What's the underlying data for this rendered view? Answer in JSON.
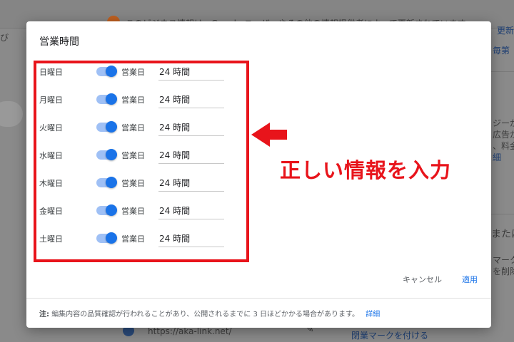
{
  "background": {
    "top_notice": "このビジネス情報は、Google ユーザーやその他の情報提供者によって更新されています",
    "left_fragment": "び",
    "right_top_link": "更新",
    "right_top_text": "毎第",
    "right_mid": [
      "ジーが",
      "広告が",
      "、料金",
      "細"
    ],
    "right_lower": [
      "または",
      "マークを",
      "を削除"
    ],
    "url": "https://aka-link.net/",
    "bottom_right_link": "閉業マークを付ける"
  },
  "dialog": {
    "title": "営業時間",
    "days": [
      {
        "day": "日曜日",
        "status": "営業日",
        "hours": "24 時間"
      },
      {
        "day": "月曜日",
        "status": "営業日",
        "hours": "24 時間"
      },
      {
        "day": "火曜日",
        "status": "営業日",
        "hours": "24 時間"
      },
      {
        "day": "水曜日",
        "status": "営業日",
        "hours": "24 時間"
      },
      {
        "day": "木曜日",
        "status": "営業日",
        "hours": "24 時間"
      },
      {
        "day": "金曜日",
        "status": "営業日",
        "hours": "24 時間"
      },
      {
        "day": "土曜日",
        "status": "営業日",
        "hours": "24 時間"
      }
    ],
    "cancel_label": "キャンセル",
    "apply_label": "適用",
    "footer": {
      "note_label": "注:",
      "note_text": "編集内容の品質確認が行われることがあり、公開されるまでに 3 日ほどかかる場合があります。",
      "details_link": "詳細"
    }
  },
  "annotation": {
    "text": "正しい情報を入力",
    "color": "#e8141b"
  },
  "colors": {
    "accent": "#1a73e8",
    "toggle_track": "#9fc0f5"
  }
}
